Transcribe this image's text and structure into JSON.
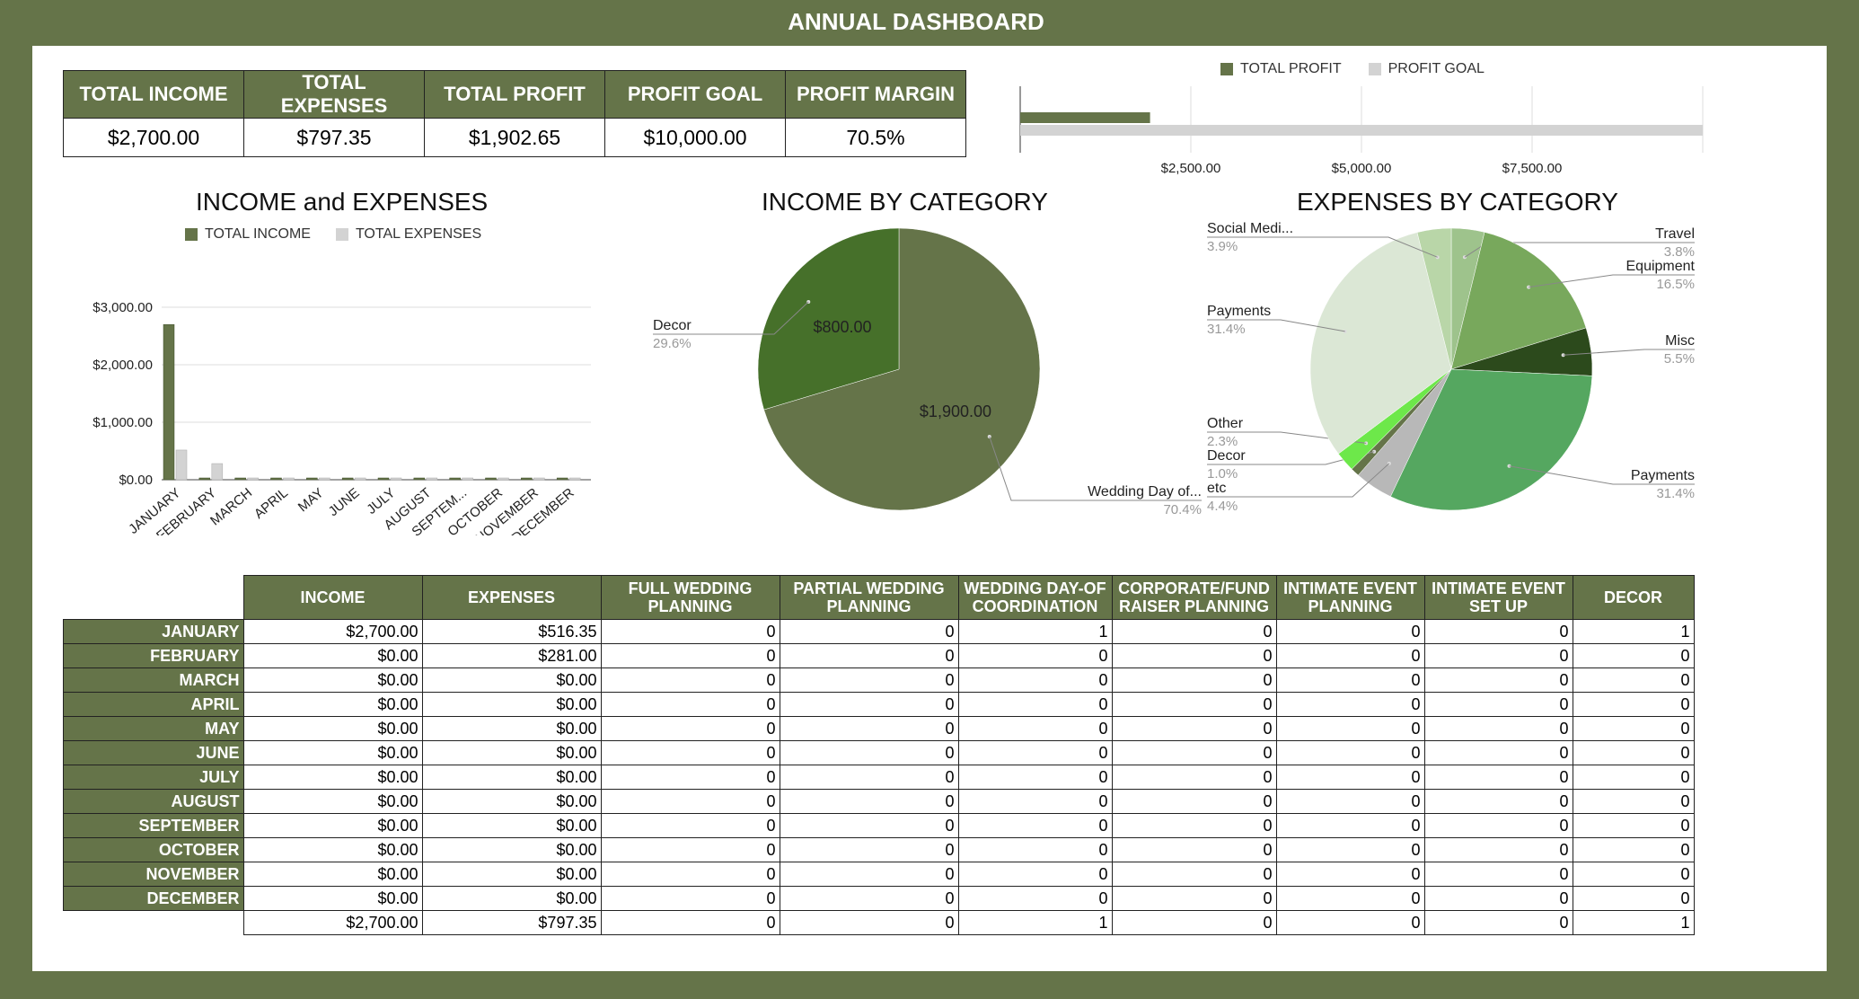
{
  "title": "ANNUAL DASHBOARD",
  "summary": {
    "headers": [
      "TOTAL INCOME",
      "TOTAL EXPENSES",
      "TOTAL PROFIT",
      "PROFIT GOAL",
      "PROFIT MARGIN"
    ],
    "values": [
      "$2,700.00",
      "$797.35",
      "$1,902.65",
      "$10,000.00",
      "70.5%"
    ]
  },
  "chart_data": [
    {
      "type": "bar",
      "orientation": "horizontal",
      "series": [
        {
          "name": "TOTAL PROFIT",
          "values": [
            1902.65
          ],
          "color": "#657449"
        },
        {
          "name": "PROFIT GOAL",
          "values": [
            10000
          ],
          "color": "#d3d3d3"
        }
      ],
      "xticks": [
        "$2,500.00",
        "$5,000.00",
        "$7,500.00"
      ],
      "xlim": [
        0,
        10000
      ],
      "legend": "top"
    },
    {
      "type": "bar",
      "title": "INCOME and EXPENSES",
      "categories": [
        "JANUARY",
        "FEBRUARY",
        "MARCH",
        "APRIL",
        "MAY",
        "JUNE",
        "JULY",
        "AUGUST",
        "SEPTEM...",
        "OCTOBER",
        "NOVEMBER",
        "DECEMBER"
      ],
      "series": [
        {
          "name": "TOTAL INCOME",
          "values": [
            2700,
            0,
            0,
            0,
            0,
            0,
            0,
            0,
            0,
            0,
            0,
            0
          ],
          "color": "#657449"
        },
        {
          "name": "TOTAL EXPENSES",
          "values": [
            516.35,
            281,
            0,
            0,
            0,
            0,
            0,
            0,
            0,
            0,
            0,
            0
          ],
          "color": "#d3d3d3"
        }
      ],
      "yticks": [
        "$0.00",
        "$1,000.00",
        "$2,000.00",
        "$3,000.00"
      ],
      "ylim": [
        0,
        3000
      ],
      "legend": "top"
    },
    {
      "type": "pie",
      "title": "INCOME BY CATEGORY",
      "slices": [
        {
          "label": "Wedding Day of...",
          "pct": "70.4%",
          "value": 1900,
          "value_label": "$1,900.00",
          "color": "#657449"
        },
        {
          "label": "Decor",
          "pct": "29.6%",
          "value": 800,
          "value_label": "$800.00",
          "color": "#46702a"
        }
      ]
    },
    {
      "type": "pie",
      "title": "EXPENSES BY CATEGORY",
      "slices": [
        {
          "label": "Travel",
          "pct": "3.8%",
          "value": 3.8,
          "color": "#9ec38c"
        },
        {
          "label": "Equipment",
          "pct": "16.5%",
          "value": 16.5,
          "color": "#78a85c"
        },
        {
          "label": "Misc",
          "pct": "5.5%",
          "value": 5.5,
          "color": "#2c4a1c"
        },
        {
          "label": "Payments",
          "pct": "31.4%",
          "value": 31.4,
          "color": "#55a760"
        },
        {
          "label": "etc",
          "pct": "4.4%",
          "value": 4.4,
          "color": "#b8b8b8"
        },
        {
          "label": "Decor",
          "pct": "1.0%",
          "value": 1.0,
          "color": "#657449"
        },
        {
          "label": "Other",
          "pct": "2.3%",
          "value": 2.3,
          "color": "#6de84a"
        },
        {
          "label": "Payments",
          "pct": "31.4%",
          "value": 31.4,
          "color": "#dbe7d5"
        },
        {
          "label": "Social Medi...",
          "pct": "3.9%",
          "value": 3.9,
          "color": "#b9d6a8"
        }
      ]
    }
  ],
  "monthly": {
    "headers": [
      "INCOME",
      "EXPENSES",
      "FULL WEDDING PLANNING",
      "PARTIAL WEDDING PLANNING",
      "WEDDING DAY-OF COORDINATION",
      "CORPORATE/FUND RAISER PLANNING",
      "INTIMATE EVENT PLANNING",
      "INTIMATE EVENT SET UP",
      "DECOR"
    ],
    "rows": [
      {
        "month": "JANUARY",
        "cells": [
          "$2,700.00",
          "$516.35",
          "0",
          "0",
          "1",
          "0",
          "0",
          "0",
          "1"
        ]
      },
      {
        "month": "FEBRUARY",
        "cells": [
          "$0.00",
          "$281.00",
          "0",
          "0",
          "0",
          "0",
          "0",
          "0",
          "0"
        ]
      },
      {
        "month": "MARCH",
        "cells": [
          "$0.00",
          "$0.00",
          "0",
          "0",
          "0",
          "0",
          "0",
          "0",
          "0"
        ]
      },
      {
        "month": "APRIL",
        "cells": [
          "$0.00",
          "$0.00",
          "0",
          "0",
          "0",
          "0",
          "0",
          "0",
          "0"
        ]
      },
      {
        "month": "MAY",
        "cells": [
          "$0.00",
          "$0.00",
          "0",
          "0",
          "0",
          "0",
          "0",
          "0",
          "0"
        ]
      },
      {
        "month": "JUNE",
        "cells": [
          "$0.00",
          "$0.00",
          "0",
          "0",
          "0",
          "0",
          "0",
          "0",
          "0"
        ]
      },
      {
        "month": "JULY",
        "cells": [
          "$0.00",
          "$0.00",
          "0",
          "0",
          "0",
          "0",
          "0",
          "0",
          "0"
        ]
      },
      {
        "month": "AUGUST",
        "cells": [
          "$0.00",
          "$0.00",
          "0",
          "0",
          "0",
          "0",
          "0",
          "0",
          "0"
        ]
      },
      {
        "month": "SEPTEMBER",
        "cells": [
          "$0.00",
          "$0.00",
          "0",
          "0",
          "0",
          "0",
          "0",
          "0",
          "0"
        ]
      },
      {
        "month": "OCTOBER",
        "cells": [
          "$0.00",
          "$0.00",
          "0",
          "0",
          "0",
          "0",
          "0",
          "0",
          "0"
        ]
      },
      {
        "month": "NOVEMBER",
        "cells": [
          "$0.00",
          "$0.00",
          "0",
          "0",
          "0",
          "0",
          "0",
          "0",
          "0"
        ]
      },
      {
        "month": "DECEMBER",
        "cells": [
          "$0.00",
          "$0.00",
          "0",
          "0",
          "0",
          "0",
          "0",
          "0",
          "0"
        ]
      }
    ],
    "totals": [
      "$2,700.00",
      "$797.35",
      "0",
      "0",
      "1",
      "0",
      "0",
      "0",
      "1"
    ]
  }
}
